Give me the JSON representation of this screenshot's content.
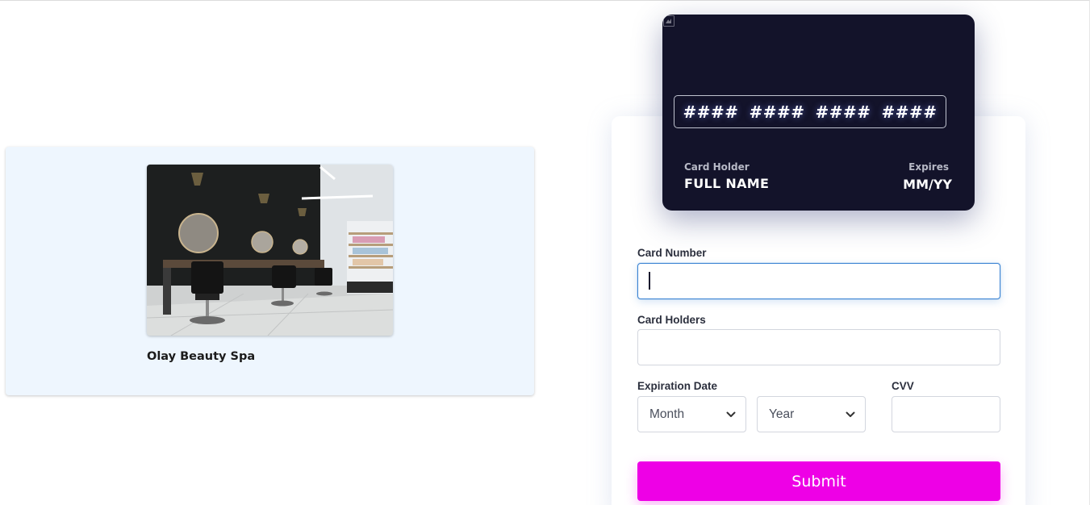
{
  "salon": {
    "name": "Olay Beauty Spa",
    "photo_alt": "Salon interior"
  },
  "card_preview": {
    "number_groups": [
      "####",
      "####",
      "####",
      "####"
    ],
    "holder_label": "Card Holder",
    "holder_value": "FULL NAME",
    "expires_label": "Expires",
    "expires_value": "MM/YY"
  },
  "form": {
    "card_number": {
      "label": "Card Number",
      "value": ""
    },
    "card_holders": {
      "label": "Card Holders",
      "value": ""
    },
    "expiration": {
      "label": "Expiration Date",
      "month_value": "Month",
      "year_value": "Year"
    },
    "cvv": {
      "label": "CVV",
      "value": ""
    },
    "submit_label": "Submit"
  },
  "colors": {
    "submit_bg": "#ee00e6",
    "card_bg": "#13132a",
    "salon_card_bg": "#eef6fe",
    "focus_border": "#3a83d3"
  }
}
